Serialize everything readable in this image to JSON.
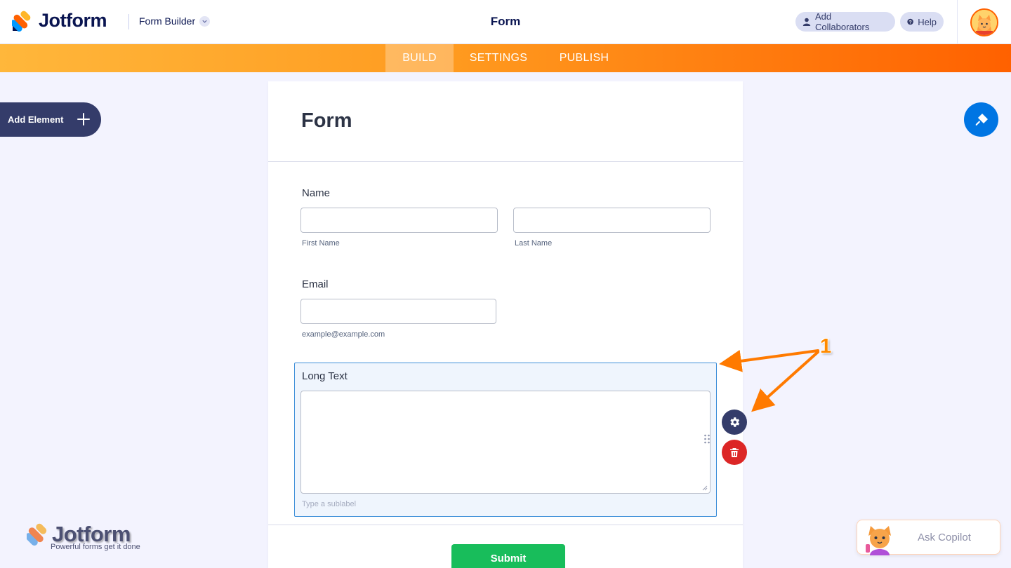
{
  "header": {
    "brand": "Jotform",
    "builder_label": "Form Builder",
    "title": "Form",
    "add_collaborators": "Add Collaborators",
    "help": "Help"
  },
  "nav": {
    "tabs": [
      {
        "label": "BUILD",
        "active": true
      },
      {
        "label": "SETTINGS",
        "active": false
      },
      {
        "label": "PUBLISH",
        "active": false
      }
    ]
  },
  "sidebar": {
    "add_element": "Add Element"
  },
  "form": {
    "title": "Form",
    "name_field": {
      "label": "Name",
      "first_value": "",
      "first_sublabel": "First Name",
      "last_value": "",
      "last_sublabel": "Last Name"
    },
    "email_field": {
      "label": "Email",
      "value": "",
      "sublabel": "example@example.com"
    },
    "long_text_field": {
      "label": "Long Text",
      "value": "",
      "sublabel_placeholder": "Type a sublabel"
    },
    "submit_label": "Submit"
  },
  "annotation": {
    "number": "1"
  },
  "watermark": {
    "brand": "Jotform",
    "tagline": "Powerful forms get it done"
  },
  "copilot": {
    "label": "Ask Copilot"
  },
  "colors": {
    "brand_navy": "#0a1551",
    "accent_orange": "#ff6100",
    "submit_green": "#18bd5b",
    "selection_blue": "#3e8fd9",
    "delete_red": "#dc2626",
    "designer_blue": "#0075e3"
  }
}
